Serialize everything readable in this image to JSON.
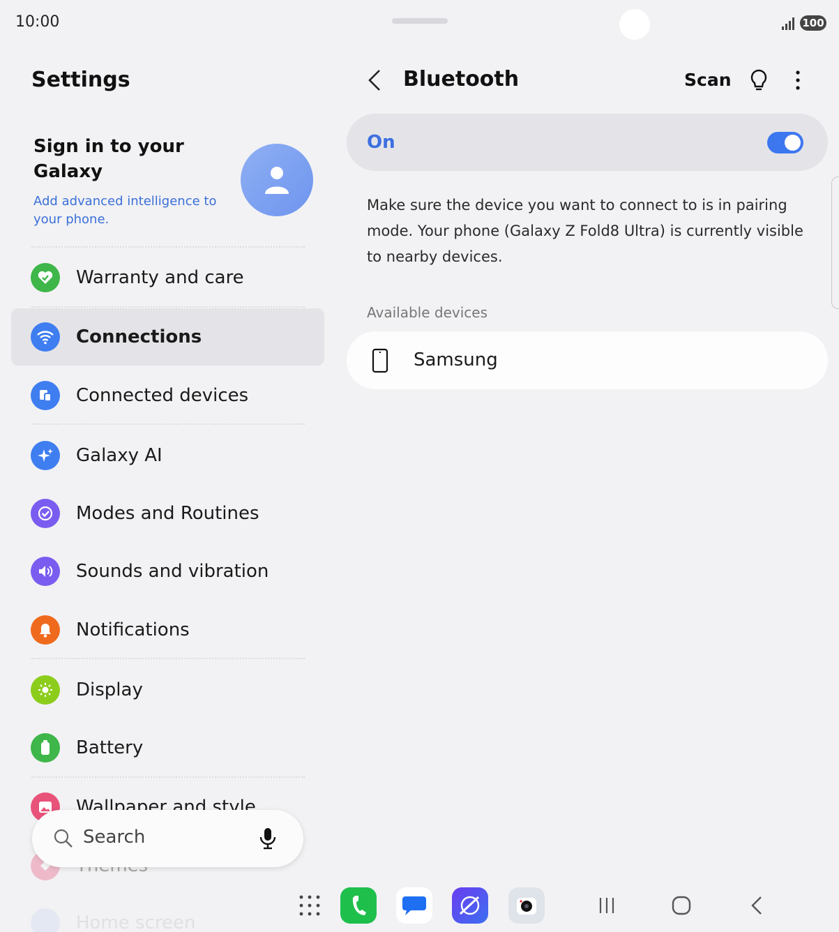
{
  "status_bar": {
    "time": "10:00",
    "battery": "100"
  },
  "left_pane": {
    "title": "Settings",
    "account": {
      "title": "Sign in to your Galaxy",
      "subtitle": "Add advanced intelligence to your phone."
    },
    "menu_items": [
      {
        "label": "Warranty and care",
        "icon": "heart-check-icon",
        "color": "#3eb649"
      },
      {
        "label": "Connections",
        "icon": "wifi-icon",
        "color": "#3f7ef0"
      },
      {
        "label": "Connected devices",
        "icon": "devices-icon",
        "color": "#3f7ef0"
      },
      {
        "label": "Galaxy AI",
        "icon": "sparkle-icon",
        "color": "#3f7ef0"
      },
      {
        "label": "Modes and Routines",
        "icon": "check-circle-icon",
        "color": "#7a5cf0"
      },
      {
        "label": "Sounds and vibration",
        "icon": "speaker-icon",
        "color": "#7a5cf0"
      },
      {
        "label": "Notifications",
        "icon": "bell-icon",
        "color": "#f06a1d"
      },
      {
        "label": "Display",
        "icon": "sun-icon",
        "color": "#8ccd1c"
      },
      {
        "label": "Battery",
        "icon": "battery-icon",
        "color": "#3eb649"
      },
      {
        "label": "Wallpaper and style",
        "icon": "image-icon",
        "color": "#e8537a"
      },
      {
        "label": "Themes",
        "icon": "themes-icon",
        "color": "#e8537a"
      },
      {
        "label": "Home screen",
        "icon": "home-icon",
        "color": "#3f7ef0"
      }
    ],
    "search": {
      "placeholder": "Search"
    }
  },
  "right_pane": {
    "title": "Bluetooth",
    "scan_label": "Scan",
    "toggle": {
      "label": "On",
      "state": true,
      "accent": "#3d77f0"
    },
    "description": "Make sure the device you want to connect to is in pairing mode. Your phone (Galaxy Z Fold8 Ultra) is currently visible to nearby devices.",
    "available_header": "Available devices",
    "devices": [
      {
        "name": "Samsung",
        "icon": "phone-icon"
      }
    ]
  },
  "taskbar": {
    "apps": [
      "apps-grid-icon",
      "phone-app-icon",
      "messages-app-icon",
      "internet-app-icon",
      "camera-app-icon"
    ],
    "nav": [
      "recents-icon",
      "home-icon",
      "back-icon"
    ]
  }
}
